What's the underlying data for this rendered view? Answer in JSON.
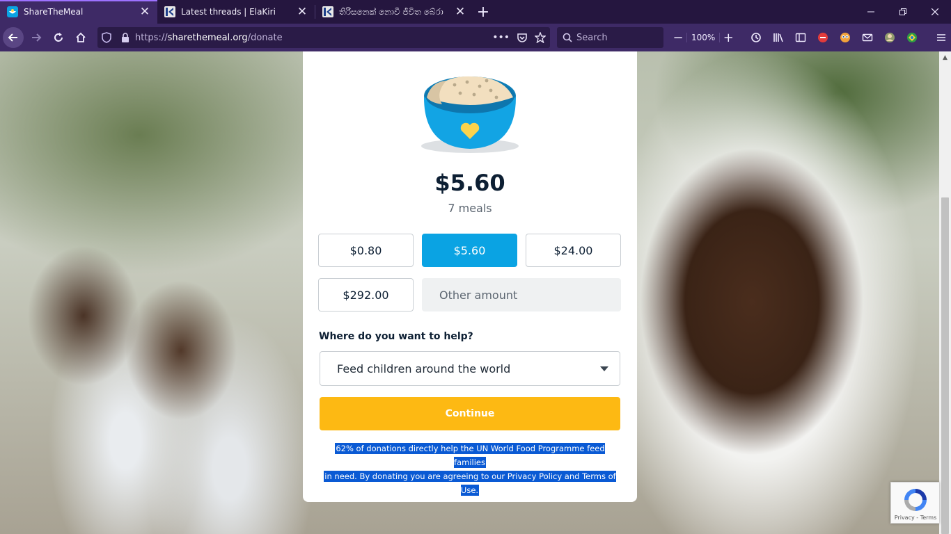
{
  "browser": {
    "tabs": [
      {
        "label": "ShareTheMeal",
        "icon": "sharethemeal-favicon",
        "active": true
      },
      {
        "label": "Latest threads | ElaKiri",
        "icon": "elakiri-favicon",
        "active": false
      },
      {
        "label": "තිරිසනෙක් නොවී ජීවිත බේරා",
        "icon": "elakiri-favicon",
        "active": false
      }
    ],
    "new_tab_label": "+",
    "url": {
      "scheme": "https://",
      "host": "sharethemeal.org",
      "path": "/donate"
    },
    "search_placeholder": "Search",
    "zoom_level": "100%",
    "accent_color": "#9d72ff"
  },
  "page": {
    "amount_display": "$5.60",
    "meals_display": "7 meals",
    "amount_options": [
      {
        "label": "$0.80",
        "selected": false
      },
      {
        "label": "$5.60",
        "selected": true
      },
      {
        "label": "$24.00",
        "selected": false
      },
      {
        "label": "$292.00",
        "selected": false
      }
    ],
    "other_amount_placeholder": "Other amount",
    "help_label": "Where do you want to help?",
    "help_selected": "Feed children around the world",
    "continue_label": "Continue",
    "disclaimer_line1": "62% of donations directly help the UN World Food Programme feed families",
    "disclaimer_line2": "in need. By donating you are agreeing to our Privacy Policy and Terms of Use.",
    "colors": {
      "primary_blue": "#0aa3e3",
      "continue_yellow": "#fdb913",
      "heart_yellow": "#fcd34d"
    }
  },
  "recaptcha": {
    "text": "Privacy - Terms"
  }
}
